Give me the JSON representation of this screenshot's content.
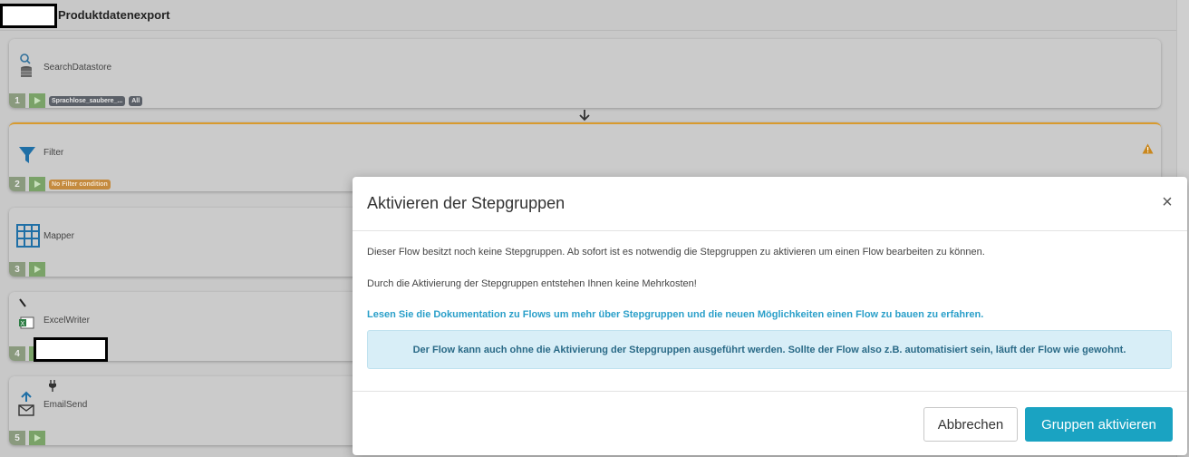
{
  "header": {
    "flow_title": "Produktdatenexport"
  },
  "steps": [
    {
      "number": "1",
      "name": "SearchDatastore",
      "tags": [
        "Sprachlose_saubere_...",
        "All"
      ],
      "icon": "search-datastore-icon"
    },
    {
      "number": "2",
      "name": "Filter",
      "tags": [
        "No Filter condition"
      ],
      "icon": "filter-icon",
      "warning": true
    },
    {
      "number": "3",
      "name": "Mapper",
      "tags": [],
      "icon": "table-icon"
    },
    {
      "number": "4",
      "name": "ExcelWriter",
      "tags": [],
      "icon": "excel-icon"
    },
    {
      "number": "5",
      "name": "EmailSend",
      "tags": [],
      "icon": "email-upload-icon"
    }
  ],
  "modal": {
    "title": "Aktivieren der Stepgruppen",
    "close_label": "×",
    "paragraph1": "Dieser Flow besitzt noch keine Stepgruppen. Ab sofort ist es notwendig die Stepgruppen zu aktivieren um einen Flow bearbeiten zu können.",
    "paragraph2": "Durch die Aktivierung der Stepgruppen entstehen Ihnen keine Mehrkosten!",
    "doc_link": "Lesen Sie die Dokumentation zu Flows um mehr über Stepgruppen und die neuen Möglichkeiten einen Flow zu bauen zu erfahren.",
    "info": "Der Flow kann auch ohne die Aktivierung der Stepgruppen ausgeführt werden. Sollte der Flow also z.B. automatisiert sein, läuft der Flow wie gewohnt.",
    "cancel_label": "Abbrechen",
    "confirm_label": "Gruppen aktivieren"
  },
  "colors": {
    "primary": "#1aa3c2",
    "link": "#2a9fc9",
    "info_bg": "#d8eef7",
    "warning": "#d89a2d"
  }
}
